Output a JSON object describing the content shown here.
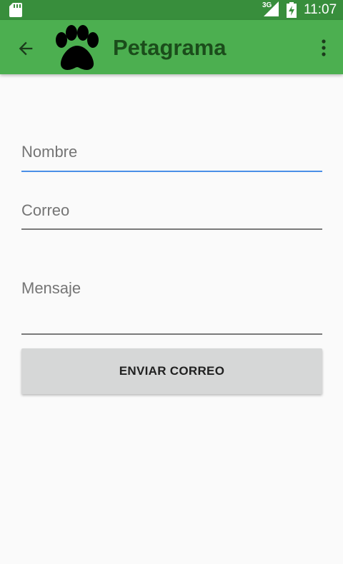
{
  "status_bar": {
    "time": "11:07",
    "network_label": "3G",
    "icons": [
      "sd-card-icon",
      "signal-icon",
      "battery-charging-icon"
    ]
  },
  "app_bar": {
    "title": "Petagrama",
    "back_icon": "arrow-back-icon",
    "logo_icon": "paw-icon",
    "menu_icon": "more-vert-icon",
    "color": "#4caf50",
    "title_color": "#1b4d1b"
  },
  "form": {
    "nombre": {
      "placeholder": "Nombre",
      "value": ""
    },
    "correo": {
      "placeholder": "Correo",
      "value": ""
    },
    "mensaje": {
      "placeholder": "Mensaje",
      "value": ""
    },
    "send_label": "ENVIAR CORREO",
    "focus_color": "#4a8fe7"
  }
}
